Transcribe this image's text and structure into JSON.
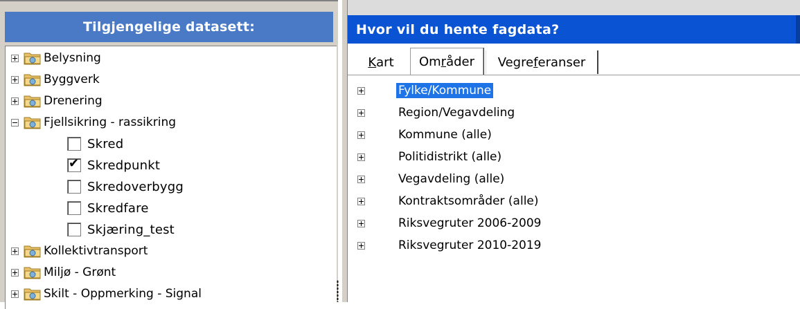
{
  "left": {
    "header": "Tilgjengelige datasett:",
    "items": [
      {
        "label": "Belysning",
        "type": "folder",
        "expanded": false
      },
      {
        "label": "Byggverk",
        "type": "folder",
        "expanded": false
      },
      {
        "label": "Drenering",
        "type": "folder",
        "expanded": false
      },
      {
        "label": "Fjellsikring - rassikring",
        "type": "folder",
        "expanded": true
      },
      {
        "label": "Skred",
        "type": "checkbox",
        "checked": false
      },
      {
        "label": "Skredpunkt",
        "type": "checkbox",
        "checked": true
      },
      {
        "label": "Skredoverbygg",
        "type": "checkbox",
        "checked": false
      },
      {
        "label": "Skredfare",
        "type": "checkbox",
        "checked": false
      },
      {
        "label": "Skjæring_test",
        "type": "checkbox",
        "checked": false
      },
      {
        "label": "Kollektivtransport",
        "type": "folder",
        "expanded": false
      },
      {
        "label": "Miljø - Grønt",
        "type": "folder",
        "expanded": false
      },
      {
        "label": "Skilt - Oppmerking - Signal",
        "type": "folder",
        "expanded": false
      }
    ],
    "check_glyph": "✔"
  },
  "right": {
    "header": "Hvor vil du hente fagdata?",
    "tabs": {
      "kart": {
        "pre": "",
        "u": "K",
        "post": "art"
      },
      "omrader": {
        "pre": "Om",
        "u": "r",
        "post": "åder"
      },
      "vegref": {
        "pre": "Vegre",
        "u": "f",
        "post": "eranser"
      }
    },
    "active_tab": "Områder",
    "items": [
      {
        "label": "Fylke/Kommune",
        "selected": true
      },
      {
        "label": "Region/Vegavdeling",
        "selected": false
      },
      {
        "label": "Kommune (alle)",
        "selected": false
      },
      {
        "label": "Politidistrikt (alle)",
        "selected": false
      },
      {
        "label": "Vegavdeling (alle)",
        "selected": false
      },
      {
        "label": "Kontraktsområder (alle)",
        "selected": false
      },
      {
        "label": "Riksvegruter 2006-2009",
        "selected": false
      },
      {
        "label": "Riksvegruter 2010-2019",
        "selected": false
      }
    ]
  },
  "colors": {
    "left_header": "#4a7ac6",
    "right_header": "#0a54d4",
    "selection": "#1e74e6",
    "folder": "#e8c26a"
  },
  "icons": {
    "folder": "folder-icon",
    "expander": "expander-icon",
    "checkbox": "checkbox"
  }
}
